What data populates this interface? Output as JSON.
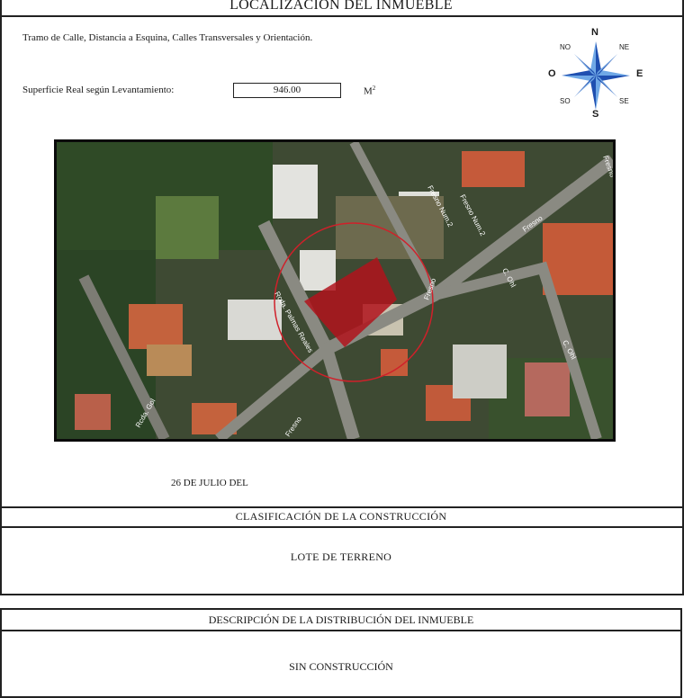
{
  "header": {
    "title": "LOCALIZACIÓN DEL INMUEBLE"
  },
  "location": {
    "description": "Tramo de Calle, Distancia a Esquina, Calles Transversales y Orientación.",
    "surface_label": "Superficie Real según Levantamiento:",
    "surface_value": "946.00",
    "surface_unit": "M",
    "surface_unit_sup": "2"
  },
  "compass": {
    "n": "N",
    "s": "S",
    "e": "E",
    "o": "O",
    "ne": "NE",
    "no": "NO",
    "se": "SE",
    "so": "SO"
  },
  "map": {
    "street_labels": [
      "Fresno Num.2",
      "Fresno Num.2",
      "Fresno",
      "Fresno",
      "Fresno",
      "C. Ohl",
      "C. Ohl",
      "Rcda. Palmas Reales",
      "Rcda. Gol",
      "Fresno"
    ]
  },
  "date": "26 DE JULIO DEL",
  "classification": {
    "title": "CLASIFICACIÓN DE LA CONSTRUCCIÓN",
    "value": "LOTE DE TERRENO"
  },
  "distribution": {
    "title": "DESCRIPCIÓN DE LA DISTRIBUCIÓN DEL INMUEBLE",
    "value": "SIN CONSTRUCCIÓN"
  },
  "colors": {
    "compass_blue": "#1f4fb0",
    "compass_light": "#6fa8e6",
    "lot_red": "#b0131c",
    "circle_red": "#d0202a"
  }
}
